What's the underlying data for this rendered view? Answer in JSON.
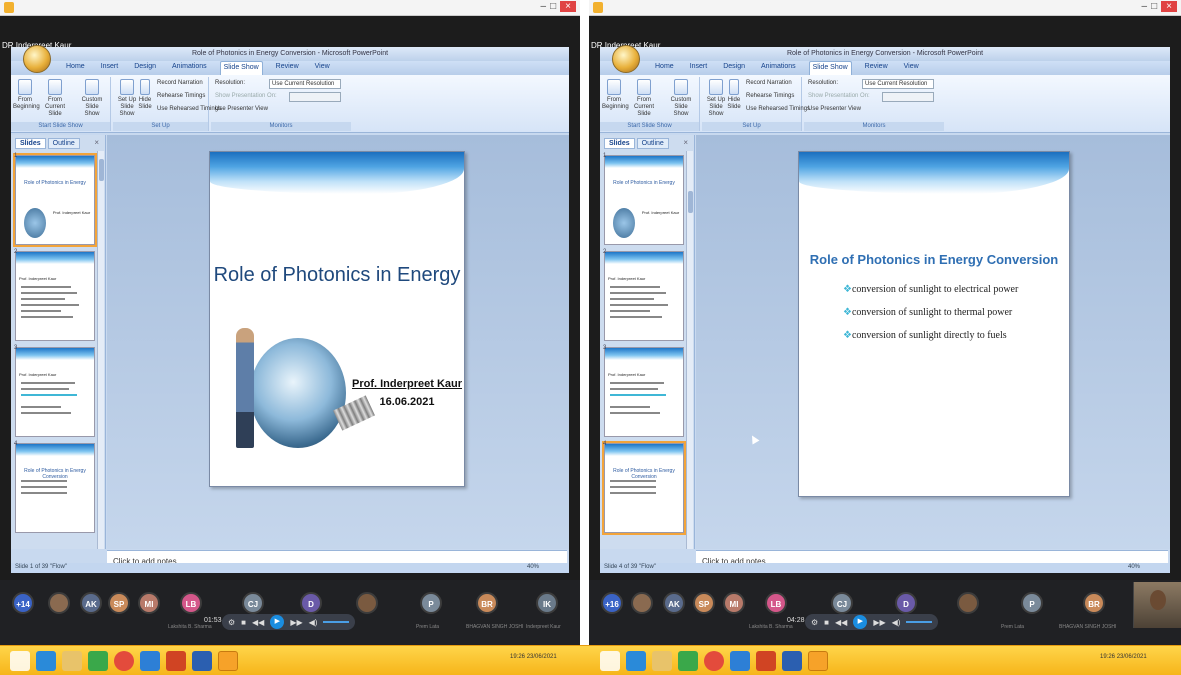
{
  "left": {
    "user": "DR.Inderpreet Kaur",
    "window_title": "Role of Photonics in Energy Conversion - Microsoft PowerPoint",
    "tabs": [
      "Home",
      "Insert",
      "Design",
      "Animations",
      "Slide Show",
      "Review",
      "View"
    ],
    "active_tab": "Slide Show",
    "ribbon": {
      "from_beginning": "From Beginning",
      "from_current": "From Current Slide",
      "custom_show": "Custom Slide Show",
      "group_start": "Start Slide Show",
      "set_up": "Set Up Slide Show",
      "hide_slide": "Hide Slide",
      "record_narration": "Record Narration",
      "rehearse_timings": "Rehearse Timings",
      "use_rehearsed": "Use Rehearsed Timings",
      "group_setup": "Set Up",
      "resolution": "Resolution:",
      "resolution_value": "Use Current Resolution",
      "show_on": "Show Presentation On:",
      "presenter_view": "Use Presenter View",
      "group_monitors": "Monitors"
    },
    "pane_tabs": [
      "Slides",
      "Outline"
    ],
    "thumbs": [
      {
        "num": "1",
        "title": "Role of Photonics in Energy"
      },
      {
        "num": "2",
        "title": "Prof. Inderpreet Kaur"
      },
      {
        "num": "3",
        "title": "Prof. Inderpreet Kaur"
      },
      {
        "num": "4",
        "title": "Role of Photonics in Energy Conversion"
      }
    ],
    "slide": {
      "title": "Role of Photonics in Energy",
      "author": "Prof. Inderpreet Kaur",
      "date": "16.06.2021"
    },
    "notes": "Click to add notes",
    "status": "Slide 1 of 39  \"Flow\"",
    "zoom": "40%",
    "participants": [
      {
        "initials": "+14",
        "color": "#3a63c6"
      },
      {
        "initials": "",
        "color": "#8a6a50"
      },
      {
        "initials": "AK",
        "color": "#5a6b8c"
      },
      {
        "initials": "SP",
        "color": "#c98a5a"
      },
      {
        "initials": "MI",
        "color": "#b87a6a"
      },
      {
        "initials": "LB",
        "color": "#d4578a"
      },
      {
        "initials": "CJ",
        "color": "#7a8a9a"
      },
      {
        "initials": "D",
        "color": "#6a5aa8"
      },
      {
        "initials": "",
        "color": "#7a5a40"
      },
      {
        "initials": "P",
        "color": "#7a8a9a"
      },
      {
        "initials": "BR",
        "color": "#c98a5a"
      },
      {
        "initials": "IK",
        "color": "#6a7a8a"
      }
    ],
    "time": "01:53",
    "names": [
      "Lakshita B. Sharma",
      "Prem Lata",
      "BHAGVAN SINGH JOSHI",
      "Inderpreet Kaur"
    ]
  },
  "right": {
    "user": "DR.Inderpreet Kaur",
    "window_title": "Role of Photonics in Energy Conversion - Microsoft PowerPoint",
    "slide": {
      "title": "Role of Photonics in Energy Conversion",
      "bullets": [
        "conversion of sunlight to electrical power",
        "conversion of sunlight to thermal power",
        "conversion of sunlight directly to fuels"
      ]
    },
    "notes": "Click to add notes",
    "status": "Slide 4 of 39  \"Flow\"",
    "zoom": "40%",
    "time": "04:28",
    "participants": [
      {
        "initials": "+16",
        "color": "#3a63c6"
      },
      {
        "initials": "",
        "color": "#8a6a50"
      },
      {
        "initials": "AK",
        "color": "#5a6b8c"
      },
      {
        "initials": "SP",
        "color": "#c98a5a"
      },
      {
        "initials": "MI",
        "color": "#b87a6a"
      },
      {
        "initials": "LB",
        "color": "#d4578a"
      },
      {
        "initials": "CJ",
        "color": "#7a8a9a"
      },
      {
        "initials": "D",
        "color": "#6a5aa8"
      },
      {
        "initials": "",
        "color": "#7a5a40"
      },
      {
        "initials": "P",
        "color": "#7a8a9a"
      },
      {
        "initials": "BR",
        "color": "#c98a5a"
      }
    ],
    "names": [
      "Lakshita B. Sharma",
      "Prem Lata",
      "BHAGVAN SINGH JOSHI"
    ]
  },
  "taskbar": {
    "left_time": "19:26",
    "left_date": "23/06/2021",
    "right_time": "19:26",
    "right_date": "23/06/2021",
    "icons": [
      "windows-icon",
      "ie-icon",
      "explorer-icon",
      "app-green-icon",
      "chrome-icon",
      "edge-icon",
      "powerpoint-icon",
      "word-icon",
      "player-icon"
    ]
  }
}
